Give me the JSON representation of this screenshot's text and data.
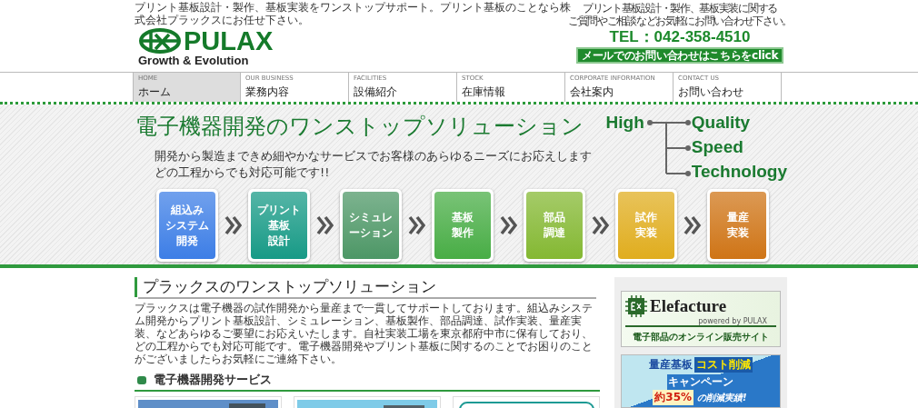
{
  "header": {
    "tagline": "プリント基板設計・製作、基板実装をワンストップサポート。プリント基板のことなら株式会社プラックスにお任せ下さい。",
    "logo": {
      "name": "PULAX",
      "slogan": "Growth & Evolution"
    },
    "contact": {
      "lines": [
        "プリント基板設計・製作、基板実装に関する",
        "ご質問やご相談などお気軽にお問い合わせ下さい。"
      ],
      "tel": "TEL：042-358-4510",
      "mail_button": "メールでのお問い合わせはこちらをclick"
    }
  },
  "nav": [
    {
      "en": "HOME",
      "ja": "ホーム",
      "selected": true
    },
    {
      "en": "OUR BUSINESS",
      "ja": "業務内容",
      "selected": false
    },
    {
      "en": "FACILITIES",
      "ja": "設備紹介",
      "selected": false
    },
    {
      "en": "STOCK",
      "ja": "在庫情報",
      "selected": false
    },
    {
      "en": "CORPORATE INFORMATION",
      "ja": "会社案内",
      "selected": false
    },
    {
      "en": "CONTACT US",
      "ja": "お問い合わせ",
      "selected": false
    }
  ],
  "hero": {
    "title": "電子機器開発のワンストップソリューション",
    "lead": [
      "開発から製造まできめ細やかなサービスでお客様のあらゆるニーズにお応えします",
      "どの工程からでも対応可能です!!"
    ],
    "tree": {
      "root": "High",
      "branches": [
        "Quality",
        "Speed",
        "Technology"
      ]
    },
    "steps": [
      {
        "lines": [
          "組込み",
          "システム",
          "開発"
        ],
        "color": "#3d7ee6"
      },
      {
        "lines": [
          "プリント",
          "基板",
          "設計"
        ],
        "color": "#179a86"
      },
      {
        "lines": [
          "シミュレ",
          "ーション"
        ],
        "color": "#4d9766"
      },
      {
        "lines": [
          "基板",
          "製作"
        ],
        "color": "#48ad45"
      },
      {
        "lines": [
          "部品",
          "調達"
        ],
        "color": "#84b832"
      },
      {
        "lines": [
          "試作",
          "実装"
        ],
        "color": "#e0ad1e"
      },
      {
        "lines": [
          "量産",
          "実装"
        ],
        "color": "#cf7416"
      }
    ]
  },
  "main": {
    "heading": "プラックスのワンストップソリューション",
    "intro": "プラックスは電子機器の試作開発から量産まで一貫してサポートしております。組込みシステム開発からプリント基板設計、シミュレーション、基板製作、部品調達、試作実装、量産実装、などあらゆるご要望にお応えいたします。自社実装工場を東京都府中市に保有しており、どの工程からでも対応可能です。電子機器開発やプリント基板に関するのことでお困りのことがございましたらお気軽にご連絡下さい。",
    "section": "電子機器開発サービス"
  },
  "sidebar": {
    "elefacture": {
      "name": "Elefacture",
      "powered": "powered by PULAX",
      "caption": "電子部品のオンライン販売サイト"
    },
    "campaign": {
      "line1": [
        "量産基板",
        "コスト削減",
        "キャンペーン"
      ],
      "line2": [
        "約35%",
        "の削減実績!"
      ]
    }
  }
}
